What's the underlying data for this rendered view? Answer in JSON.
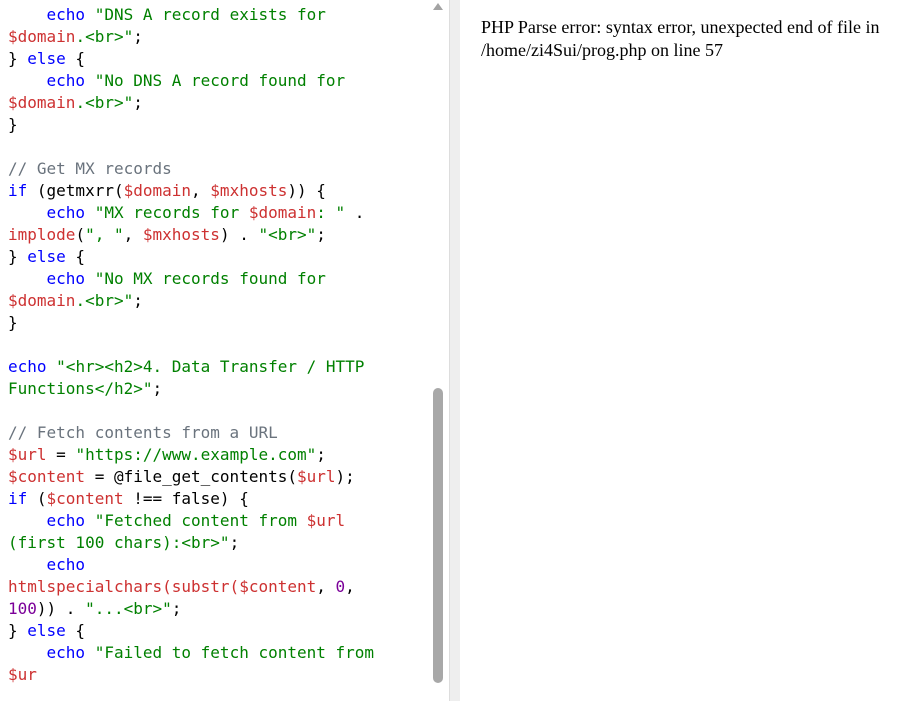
{
  "editor": {
    "lines": [
      [
        {
          "t": "    echo ",
          "c": "kw"
        },
        {
          "t": "\"DNS A record exists for",
          "c": "str"
        }
      ],
      [
        {
          "t": "$domain",
          "c": "var"
        },
        {
          "t": ".<br>\"",
          "c": "str"
        },
        {
          "t": ";",
          "c": "plain"
        }
      ],
      [
        {
          "t": "} ",
          "c": "plain"
        },
        {
          "t": "else",
          "c": "kw"
        },
        {
          "t": " {",
          "c": "plain"
        }
      ],
      [
        {
          "t": "    echo ",
          "c": "kw"
        },
        {
          "t": "\"No DNS A record found for",
          "c": "str"
        }
      ],
      [
        {
          "t": "$domain",
          "c": "var"
        },
        {
          "t": ".<br>\"",
          "c": "str"
        },
        {
          "t": ";",
          "c": "plain"
        }
      ],
      [
        {
          "t": "}",
          "c": "plain"
        }
      ],
      [
        {
          "t": "",
          "c": "plain"
        }
      ],
      [
        {
          "t": "// Get MX records",
          "c": "cmt"
        }
      ],
      [
        {
          "t": "if",
          "c": "kw"
        },
        {
          "t": " (getmxrr(",
          "c": "plain"
        },
        {
          "t": "$domain",
          "c": "var"
        },
        {
          "t": ", ",
          "c": "plain"
        },
        {
          "t": "$mxhosts",
          "c": "var"
        },
        {
          "t": ")) {",
          "c": "plain"
        }
      ],
      [
        {
          "t": "    echo ",
          "c": "kw"
        },
        {
          "t": "\"MX records for ",
          "c": "str"
        },
        {
          "t": "$domain",
          "c": "var"
        },
        {
          "t": ": \"",
          "c": "str"
        },
        {
          "t": " .",
          "c": "plain"
        }
      ],
      [
        {
          "t": "implode",
          "c": "func"
        },
        {
          "t": "(",
          "c": "plain"
        },
        {
          "t": "\", \"",
          "c": "str"
        },
        {
          "t": ", ",
          "c": "plain"
        },
        {
          "t": "$mxhosts",
          "c": "var"
        },
        {
          "t": ") . ",
          "c": "plain"
        },
        {
          "t": "\"<br>\"",
          "c": "str"
        },
        {
          "t": ";",
          "c": "plain"
        }
      ],
      [
        {
          "t": "} ",
          "c": "plain"
        },
        {
          "t": "else",
          "c": "kw"
        },
        {
          "t": " {",
          "c": "plain"
        }
      ],
      [
        {
          "t": "    echo ",
          "c": "kw"
        },
        {
          "t": "\"No MX records found for",
          "c": "str"
        }
      ],
      [
        {
          "t": "$domain",
          "c": "var"
        },
        {
          "t": ".<br>\"",
          "c": "str"
        },
        {
          "t": ";",
          "c": "plain"
        }
      ],
      [
        {
          "t": "}",
          "c": "plain"
        }
      ],
      [
        {
          "t": "",
          "c": "plain"
        }
      ],
      [
        {
          "t": "echo ",
          "c": "kw"
        },
        {
          "t": "\"<hr><h2>4. Data Transfer / HTTP",
          "c": "str"
        }
      ],
      [
        {
          "t": "Functions</h2>\"",
          "c": "str"
        },
        {
          "t": ";",
          "c": "plain"
        }
      ],
      [
        {
          "t": "",
          "c": "plain"
        }
      ],
      [
        {
          "t": "// Fetch contents from a URL",
          "c": "cmt"
        }
      ],
      [
        {
          "t": "$url",
          "c": "var"
        },
        {
          "t": " = ",
          "c": "plain"
        },
        {
          "t": "\"https://www.example.com\"",
          "c": "str"
        },
        {
          "t": ";",
          "c": "plain"
        }
      ],
      [
        {
          "t": "$content",
          "c": "var"
        },
        {
          "t": " = @file_get_contents(",
          "c": "plain"
        },
        {
          "t": "$url",
          "c": "var"
        },
        {
          "t": ");",
          "c": "plain"
        }
      ],
      [
        {
          "t": "if",
          "c": "kw"
        },
        {
          "t": " (",
          "c": "plain"
        },
        {
          "t": "$content",
          "c": "var"
        },
        {
          "t": " !== false) {",
          "c": "plain"
        }
      ],
      [
        {
          "t": "    echo ",
          "c": "kw"
        },
        {
          "t": "\"Fetched content from ",
          "c": "str"
        },
        {
          "t": "$url",
          "c": "var"
        }
      ],
      [
        {
          "t": "(first 100 chars):<br>\"",
          "c": "str"
        },
        {
          "t": ";",
          "c": "plain"
        }
      ],
      [
        {
          "t": "    echo",
          "c": "kw"
        }
      ],
      [
        {
          "t": "htmlspecialchars(substr(",
          "c": "func"
        },
        {
          "t": "$content",
          "c": "var"
        },
        {
          "t": ", ",
          "c": "plain"
        },
        {
          "t": "0",
          "c": "num"
        },
        {
          "t": ",",
          "c": "plain"
        }
      ],
      [
        {
          "t": "100",
          "c": "num"
        },
        {
          "t": ")) . ",
          "c": "plain"
        },
        {
          "t": "\"...<br>\"",
          "c": "str"
        },
        {
          "t": ";",
          "c": "plain"
        }
      ],
      [
        {
          "t": "} ",
          "c": "plain"
        },
        {
          "t": "else",
          "c": "kw"
        },
        {
          "t": " {",
          "c": "plain"
        }
      ],
      [
        {
          "t": "    echo ",
          "c": "kw"
        },
        {
          "t": "\"Failed to fetch content from",
          "c": "str"
        }
      ],
      [
        {
          "t": "$ur",
          "c": "var"
        }
      ]
    ],
    "colors": {
      "keyword": "#0000ff",
      "string": "#008000",
      "variable": "#cd3131",
      "number": "#7b0099",
      "comment": "#6a737d"
    }
  },
  "scrollbar": {
    "up_icon": "triangle-up-icon",
    "thumb_position_fraction": 0.55
  },
  "output": {
    "text": "PHP Parse error: syntax error, unexpected end of file in /home/zi4Sui/prog.php on line 57"
  }
}
